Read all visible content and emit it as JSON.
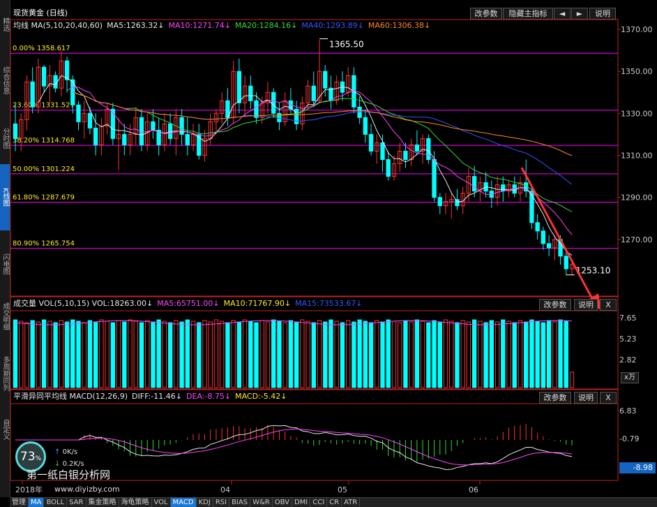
{
  "title": "现货黄金 (日线)",
  "top_buttons": {
    "edit_params": "改参数",
    "hide_main": "隐藏主指标",
    "left": "◄",
    "right": "►",
    "help": "说明"
  },
  "left_tabs": [
    "精选",
    "综合信息",
    "分时图",
    "K线图",
    "闪电图",
    "成交明细",
    "多周期同列",
    "自定义"
  ],
  "active_left_tab": 3,
  "ma_legend": [
    {
      "label": "均线 MA(5,10,20,40,60)",
      "color": "#e8e8e8"
    },
    {
      "label": "MA5:1263.32↓",
      "color": "#e8e8e8"
    },
    {
      "label": "MA10:1271.74↓",
      "color": "#ff44ff"
    },
    {
      "label": "MA20:1284.16↓",
      "color": "#33dd33"
    },
    {
      "label": "MA40:1293.89↓",
      "color": "#3355ff"
    },
    {
      "label": "MA60:1306.38↓",
      "color": "#ff8822"
    }
  ],
  "price_axis": [
    "1370.00",
    "1350.00",
    "1330.00",
    "1310.00",
    "1290.00",
    "1270.00"
  ],
  "fib_levels": [
    {
      "label": "0.00% 1358.617",
      "price": 1358.617
    },
    {
      "label": "23.60% 1331.527",
      "price": 1331.527
    },
    {
      "label": "38.20% 1314.768",
      "price": 1314.768
    },
    {
      "label": "50.00% 1301.224",
      "price": 1301.224
    },
    {
      "label": "61.80% 1287.679",
      "price": 1287.679
    },
    {
      "label": "80.90% 1265.754",
      "price": 1265.754
    }
  ],
  "annotations": {
    "high": "1365.50",
    "low": "1253.10"
  },
  "volume": {
    "legend": [
      {
        "label": "成交量 VOL(5,10,15) VOL:18263.00↓",
        "color": "#e8e8e8"
      },
      {
        "label": "MA5:65751.00↓",
        "color": "#ff44ff"
      },
      {
        "label": "MA10:71767.90↓",
        "color": "#ffee22"
      },
      {
        "label": "MA15:73533.67↓",
        "color": "#3355ff"
      }
    ],
    "axis": [
      "7.65",
      "5.23",
      "2.82"
    ],
    "unit": "x万",
    "edit": "改参数",
    "help": "说明",
    "close": "X"
  },
  "macd": {
    "legend": [
      {
        "label": "平滑异同平均线 MACD(12,26,9)",
        "color": "#e8e8e8"
      },
      {
        "label": "DIFF:-11.46↓",
        "color": "#e8e8e8"
      },
      {
        "label": "DEA:-8.75↓",
        "color": "#ff44ff"
      },
      {
        "label": "MACD:-5.42↓",
        "color": "#ffee22"
      }
    ],
    "axis": [
      "6.83",
      "-0.79"
    ],
    "current": "-8.98",
    "edit": "改参数",
    "help": "说明",
    "close": "X"
  },
  "time_axis": [
    "2018年",
    "04",
    "05",
    "06"
  ],
  "bottom_tabs": [
    "管理",
    "MA",
    "BOLL",
    "SAR",
    "集金策略",
    "海龟策略",
    "VOL",
    "MACD",
    "KDJ",
    "RSI",
    "BIAS",
    "W&R",
    "OBV",
    "DMI",
    "CCI",
    "CR",
    "ATR"
  ],
  "active_bottom_tabs": [
    "MA",
    "MACD"
  ],
  "gauge": {
    "percent": "73",
    "unit": "%",
    "up_speed": "0K/s",
    "down_speed": "0.2K/s"
  },
  "watermark": {
    "line1": "第一纸白银分析网",
    "line2": "www.diyizby.com"
  },
  "colors": {
    "up": "#ff3333",
    "down": "#00ffff",
    "fib": "#ff00ff"
  },
  "chart_data": {
    "type": "candlestick",
    "ohlc": [
      [
        1325,
        1334,
        1312,
        1318
      ],
      [
        1318,
        1330,
        1312,
        1327
      ],
      [
        1327,
        1348,
        1322,
        1345
      ],
      [
        1345,
        1352,
        1330,
        1333
      ],
      [
        1333,
        1356,
        1330,
        1352
      ],
      [
        1352,
        1353,
        1340,
        1343
      ],
      [
        1343,
        1353,
        1335,
        1348
      ],
      [
        1348,
        1350,
        1340,
        1342
      ],
      [
        1342,
        1360,
        1338,
        1355
      ],
      [
        1355,
        1357,
        1340,
        1346
      ],
      [
        1346,
        1348,
        1330,
        1334
      ],
      [
        1334,
        1336,
        1322,
        1326
      ],
      [
        1326,
        1336,
        1318,
        1330
      ],
      [
        1330,
        1333,
        1320,
        1323
      ],
      [
        1323,
        1330,
        1310,
        1315
      ],
      [
        1315,
        1328,
        1310,
        1324
      ],
      [
        1324,
        1335,
        1320,
        1332
      ],
      [
        1332,
        1335,
        1315,
        1318
      ],
      [
        1318,
        1328,
        1303,
        1320
      ],
      [
        1320,
        1325,
        1310,
        1315
      ],
      [
        1315,
        1325,
        1310,
        1320
      ],
      [
        1320,
        1333,
        1315,
        1328
      ],
      [
        1328,
        1332,
        1312,
        1315
      ],
      [
        1315,
        1330,
        1312,
        1326
      ],
      [
        1326,
        1332,
        1318,
        1322
      ],
      [
        1322,
        1328,
        1310,
        1315
      ],
      [
        1315,
        1330,
        1312,
        1325
      ],
      [
        1325,
        1330,
        1315,
        1318
      ],
      [
        1318,
        1332,
        1310,
        1328
      ],
      [
        1328,
        1332,
        1315,
        1320
      ],
      [
        1320,
        1328,
        1310,
        1315
      ],
      [
        1315,
        1325,
        1312,
        1320
      ],
      [
        1320,
        1325,
        1308,
        1310
      ],
      [
        1310,
        1322,
        1307,
        1318
      ],
      [
        1318,
        1330,
        1315,
        1326
      ],
      [
        1326,
        1332,
        1320,
        1330
      ],
      [
        1330,
        1340,
        1325,
        1336
      ],
      [
        1336,
        1342,
        1324,
        1328
      ],
      [
        1328,
        1355,
        1325,
        1350
      ],
      [
        1350,
        1356,
        1330,
        1335
      ],
      [
        1335,
        1348,
        1328,
        1343
      ],
      [
        1343,
        1348,
        1332,
        1336
      ],
      [
        1336,
        1340,
        1325,
        1328
      ],
      [
        1328,
        1338,
        1325,
        1335
      ],
      [
        1335,
        1345,
        1330,
        1340
      ],
      [
        1340,
        1342,
        1328,
        1330
      ],
      [
        1330,
        1335,
        1322,
        1326
      ],
      [
        1326,
        1340,
        1324,
        1336
      ],
      [
        1336,
        1342,
        1330,
        1332
      ],
      [
        1332,
        1336,
        1322,
        1325
      ],
      [
        1325,
        1338,
        1322,
        1335
      ],
      [
        1335,
        1346,
        1332,
        1343
      ],
      [
        1343,
        1350,
        1333,
        1336
      ],
      [
        1336,
        1365,
        1335,
        1350
      ],
      [
        1350,
        1353,
        1338,
        1342
      ],
      [
        1342,
        1348,
        1332,
        1336
      ],
      [
        1336,
        1348,
        1334,
        1345
      ],
      [
        1345,
        1350,
        1336,
        1340
      ],
      [
        1340,
        1352,
        1338,
        1348
      ],
      [
        1348,
        1352,
        1330,
        1333
      ],
      [
        1333,
        1338,
        1325,
        1328
      ],
      [
        1328,
        1332,
        1316,
        1320
      ],
      [
        1320,
        1325,
        1310,
        1312
      ],
      [
        1312,
        1320,
        1306,
        1316
      ],
      [
        1316,
        1320,
        1302,
        1308
      ],
      [
        1308,
        1312,
        1298,
        1300
      ],
      [
        1300,
        1310,
        1298,
        1306
      ],
      [
        1306,
        1316,
        1302,
        1312
      ],
      [
        1312,
        1316,
        1304,
        1308
      ],
      [
        1308,
        1318,
        1305,
        1315
      ],
      [
        1315,
        1322,
        1310,
        1312
      ],
      [
        1312,
        1320,
        1306,
        1318
      ],
      [
        1318,
        1320,
        1306,
        1308
      ],
      [
        1308,
        1312,
        1288,
        1290
      ],
      [
        1290,
        1292,
        1282,
        1286
      ],
      [
        1286,
        1292,
        1282,
        1288
      ],
      [
        1288,
        1292,
        1280,
        1289
      ],
      [
        1289,
        1294,
        1284,
        1286
      ],
      [
        1286,
        1295,
        1282,
        1292
      ],
      [
        1292,
        1304,
        1288,
        1300
      ],
      [
        1300,
        1305,
        1290,
        1293
      ],
      [
        1293,
        1300,
        1288,
        1297
      ],
      [
        1297,
        1302,
        1290,
        1293
      ],
      [
        1293,
        1298,
        1285,
        1290
      ],
      [
        1290,
        1300,
        1286,
        1296
      ],
      [
        1296,
        1300,
        1288,
        1293
      ],
      [
        1293,
        1298,
        1290,
        1296
      ],
      [
        1296,
        1300,
        1290,
        1292
      ],
      [
        1292,
        1300,
        1288,
        1297
      ],
      [
        1297,
        1308,
        1290,
        1293
      ],
      [
        1293,
        1296,
        1275,
        1278
      ],
      [
        1278,
        1282,
        1270,
        1274
      ],
      [
        1274,
        1276,
        1265,
        1268
      ],
      [
        1268,
        1272,
        1262,
        1266
      ],
      [
        1266,
        1272,
        1260,
        1270
      ],
      [
        1270,
        1272,
        1258,
        1262
      ],
      [
        1262,
        1265,
        1253,
        1256
      ],
      [
        1256,
        1260,
        1253,
        1258
      ]
    ]
  }
}
